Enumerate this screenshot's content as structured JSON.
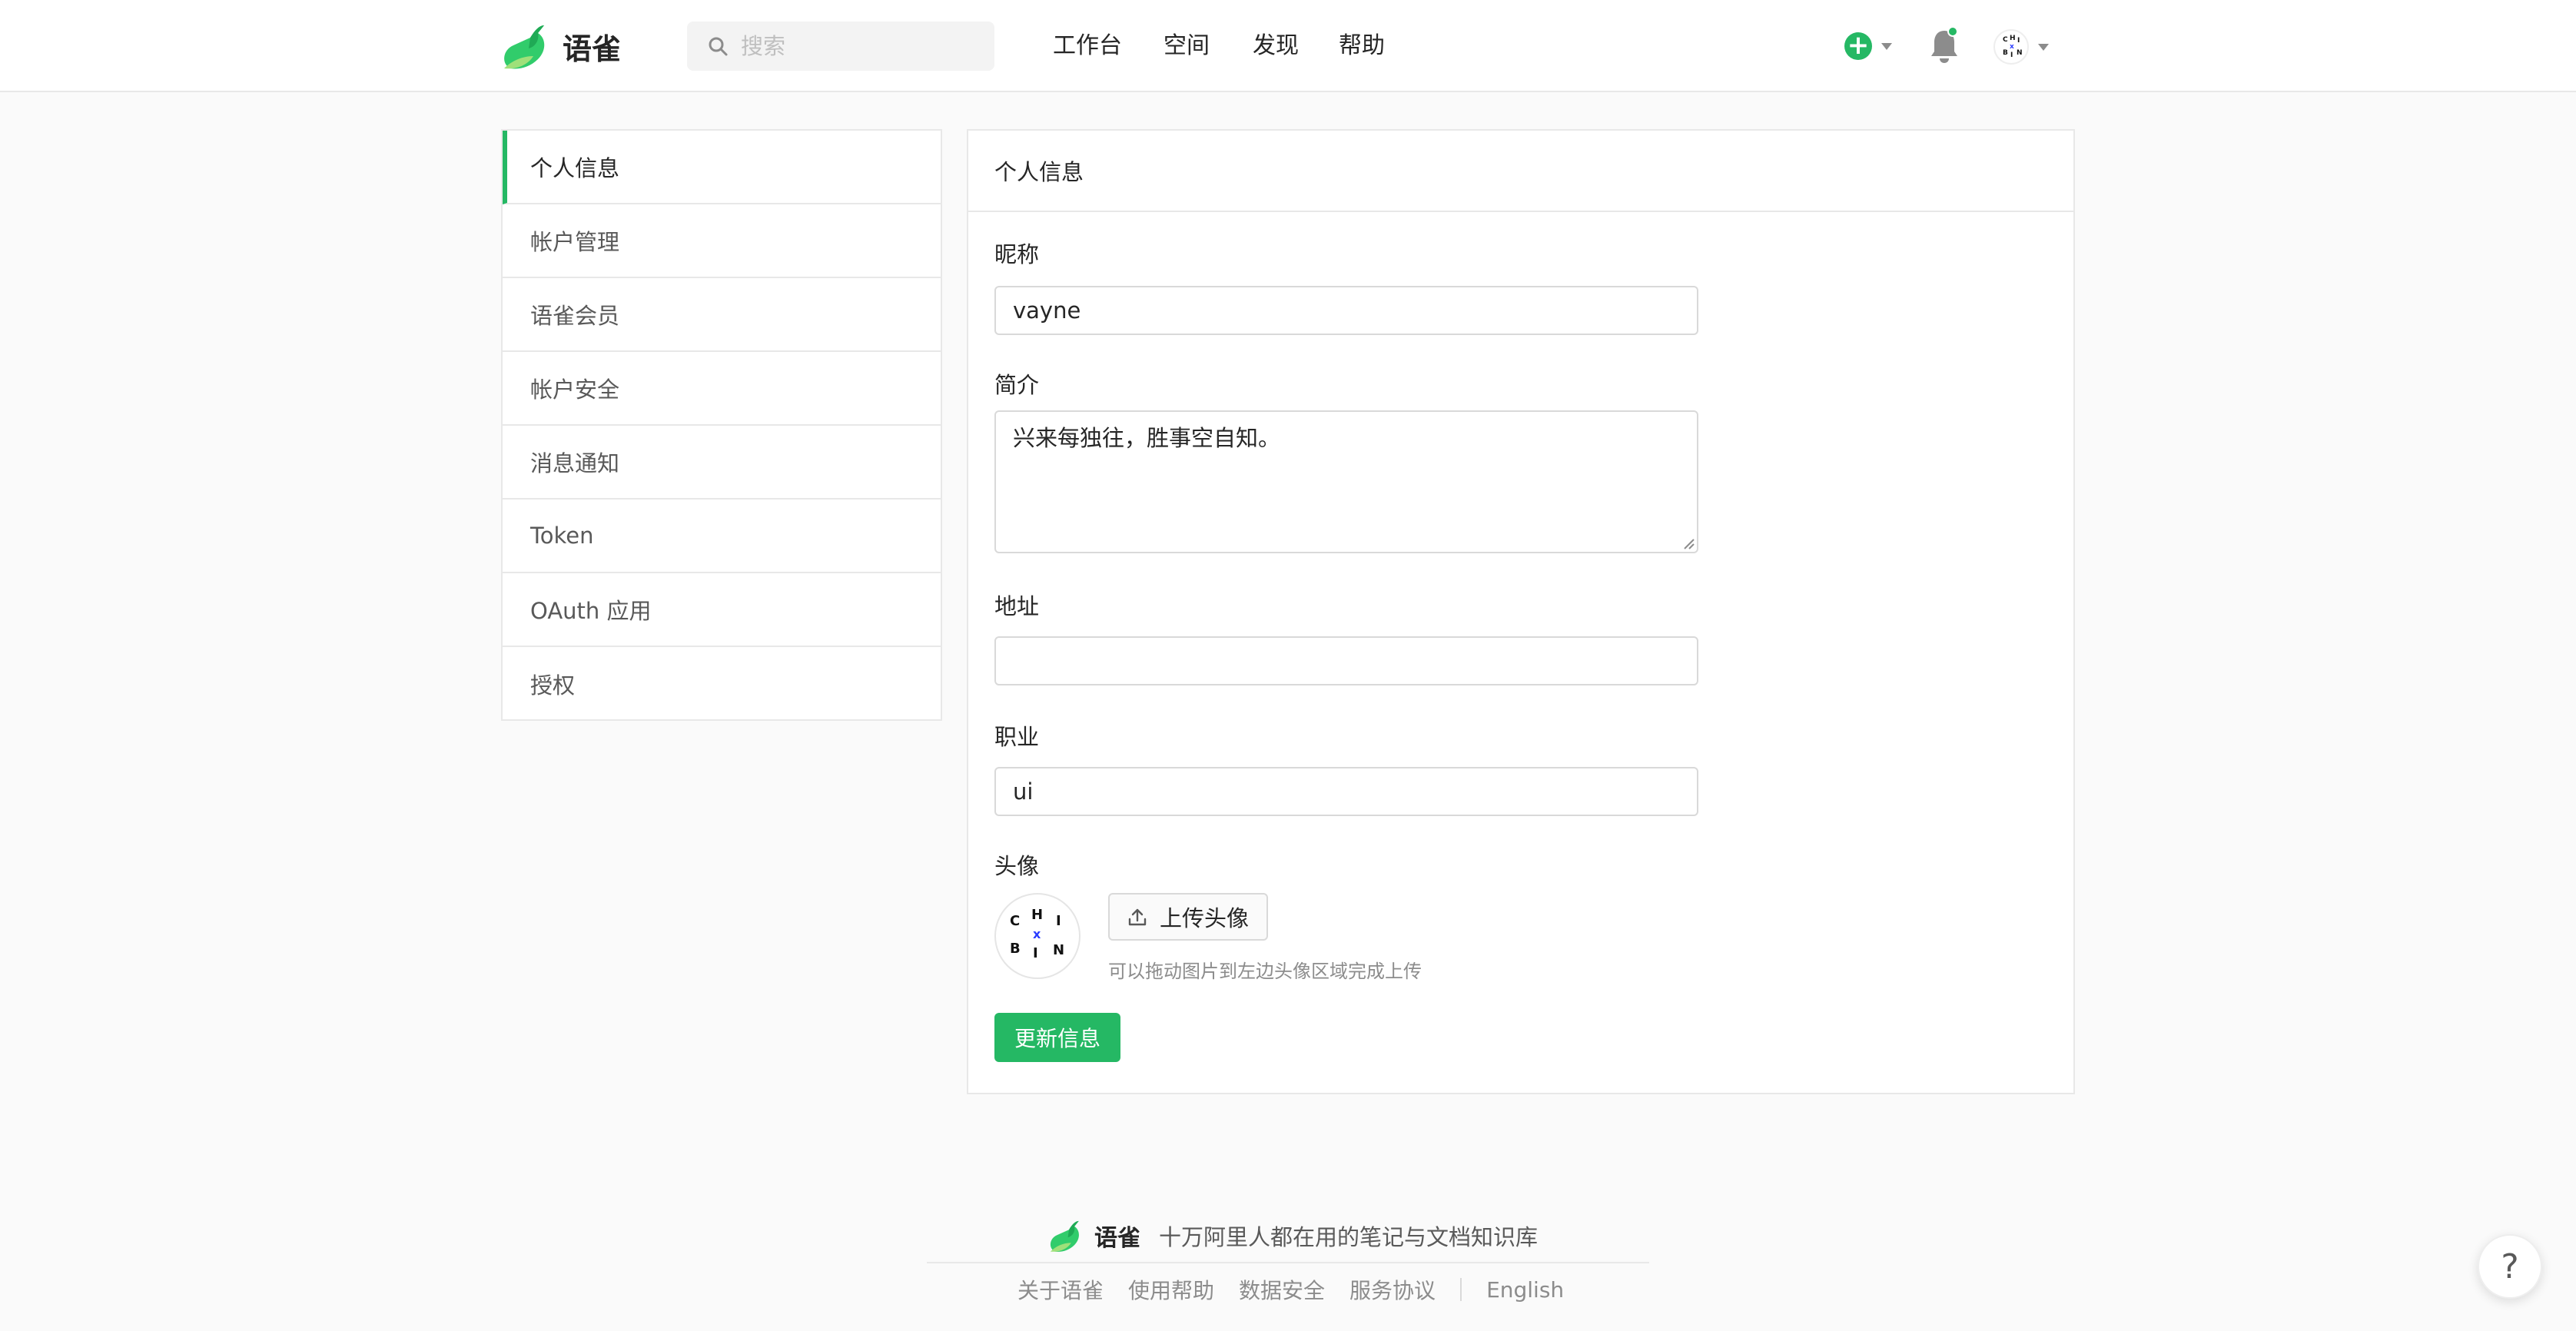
{
  "header": {
    "logo_text": "语雀",
    "search_placeholder": "搜索",
    "nav": [
      "工作台",
      "空间",
      "发现",
      "帮助"
    ],
    "add_icon": "plus-circle-icon",
    "bell_icon": "bell-icon",
    "accent": "#25b864"
  },
  "sidebar": {
    "items": [
      {
        "label": "个人信息",
        "active": true
      },
      {
        "label": "帐户管理"
      },
      {
        "label": "语雀会员"
      },
      {
        "label": "帐户安全"
      },
      {
        "label": "消息通知"
      },
      {
        "label": "Token"
      },
      {
        "label": "OAuth 应用"
      },
      {
        "label": "授权"
      }
    ]
  },
  "profile": {
    "title": "个人信息",
    "nickname_label": "昵称",
    "nickname_value": "vayne",
    "bio_label": "简介",
    "bio_value": "兴来每独往，胜事空自知。",
    "address_label": "地址",
    "address_value": "",
    "job_label": "职业",
    "job_value": "ui",
    "avatar_label": "头像",
    "avatar_letters": [
      "C",
      "H",
      "I",
      "B",
      "I",
      "N",
      "x"
    ],
    "upload_label": "上传头像",
    "upload_hint": "可以拖动图片到左边头像区域完成上传",
    "submit_label": "更新信息"
  },
  "footer": {
    "logo_text": "语雀",
    "slogan": "十万阿里人都在用的笔记与文档知识库",
    "links": [
      "关于语雀",
      "使用帮助",
      "数据安全",
      "服务协议"
    ],
    "language": "English",
    "help_label": "?"
  }
}
